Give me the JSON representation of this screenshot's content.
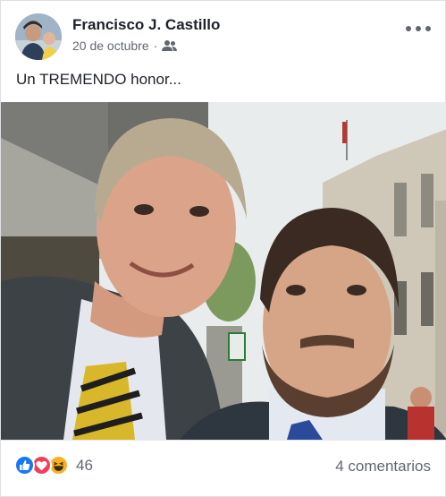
{
  "post": {
    "author": "Francisco J. Castillo",
    "date": "20 de octubre",
    "separator": "·",
    "audience_icon": "friends-icon",
    "text": "Un TREMENDO honor...",
    "more_icon": "more-options-icon"
  },
  "footer": {
    "reactions": [
      "like-icon",
      "love-icon",
      "haha-icon"
    ],
    "reaction_count": "46",
    "comments": "4 comentarios"
  },
  "colors": {
    "like": "#1877f2",
    "love": "#f33e58",
    "haha": "#f7b125",
    "secondary_text": "#606770"
  }
}
